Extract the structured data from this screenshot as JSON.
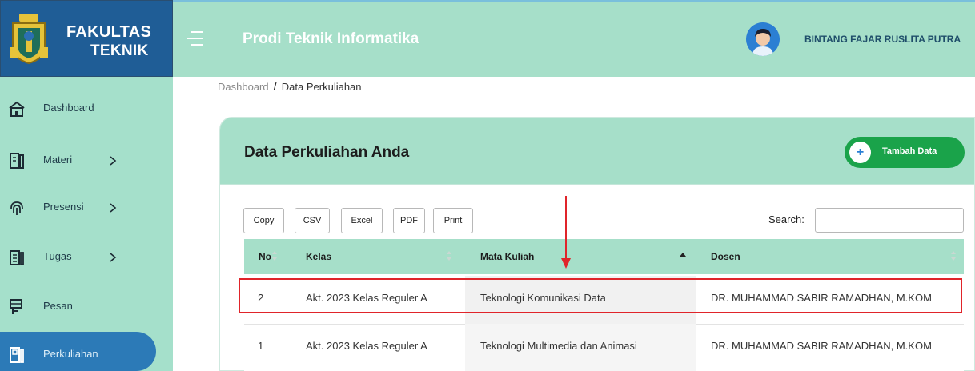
{
  "brand": {
    "line1": "FAKULTAS",
    "line2": "TEKNIK"
  },
  "topbar": {
    "title": "Prodi Teknik Informatika",
    "user_name": "BINTANG FAJAR RUSLITA PUTRA"
  },
  "sidebar": {
    "items": [
      {
        "label": "Dashboard",
        "icon": "home-icon"
      },
      {
        "label": "Materi",
        "icon": "book-icon"
      },
      {
        "label": "Presensi",
        "icon": "fingerprint-icon"
      },
      {
        "label": "Tugas",
        "icon": "clipboard-icon"
      },
      {
        "label": "Pesan",
        "icon": "message-icon"
      },
      {
        "label": "Perkuliahan",
        "icon": "class-icon"
      }
    ]
  },
  "breadcrumb": {
    "root": "Dashboard",
    "separator": "/",
    "current": "Data Perkuliahan"
  },
  "card": {
    "title": "Data Perkuliahan Anda",
    "add_plus": "+",
    "add_label": "Tambah Data"
  },
  "toolbar": {
    "copy": "Copy",
    "csv": "CSV",
    "excel": "Excel",
    "pdf": "PDF",
    "print": "Print",
    "search_label": "Search:"
  },
  "table": {
    "headers": {
      "no": "No",
      "kelas": "Kelas",
      "mata_kuliah": "Mata Kuliah",
      "dosen": "Dosen"
    },
    "rows": [
      {
        "no": "2",
        "kelas": "Akt. 2023 Kelas Reguler A",
        "mata_kuliah": "Teknologi Komunikasi Data",
        "dosen": "DR. MUHAMMAD SABIR RAMADHAN, M.KOM"
      },
      {
        "no": "1",
        "kelas": "Akt. 2023 Kelas Reguler A",
        "mata_kuliah": "Teknologi Multimedia dan Animasi",
        "dosen": "DR. MUHAMMAD SABIR RAMADHAN, M.KOM"
      }
    ]
  },
  "colors": {
    "sidebar_bg": "#a5e0cb",
    "brand_bg": "#1f5d96",
    "active_item": "#2c7ab7",
    "button_green": "#1aa34a",
    "highlight_red": "#e0242a"
  }
}
